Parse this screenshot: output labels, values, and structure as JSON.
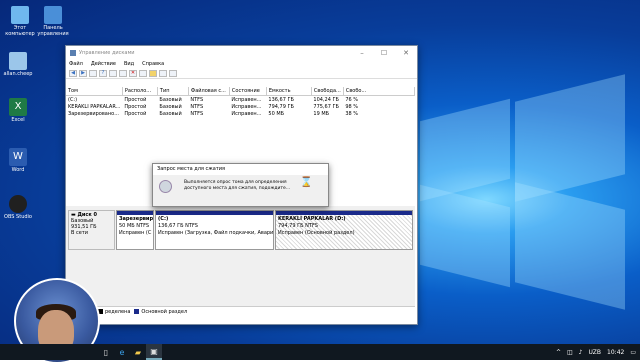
{
  "desktop": {
    "icons": [
      {
        "label": "Этот компьютер",
        "color": "#6fb7ee"
      },
      {
        "label": "Панель управления",
        "color": "#4a8fd8"
      },
      {
        "label": "allan.cheep",
        "color": "#9bc6ea"
      },
      {
        "label": "Excel",
        "color": "#1f7a45"
      },
      {
        "label": "Word",
        "color": "#2b5cb0"
      },
      {
        "label": "OBS Studio",
        "color": "#202020"
      }
    ]
  },
  "window": {
    "title": "Управление дисками",
    "menu": [
      "Файл",
      "Действие",
      "Вид",
      "Справка"
    ],
    "columns": [
      "Том",
      "Располо...",
      "Тип",
      "Файловая с...",
      "Состояние",
      "Емкость",
      "Свобода...",
      "Свобо..."
    ],
    "rows": [
      [
        "(C:)",
        "Простой",
        "Базовый",
        "NTFS",
        "Исправен...",
        "136,67 ГБ",
        "104,24 ГБ",
        "76 %"
      ],
      [
        "KERAKLI PAPKALAR...",
        "Простой",
        "Базовый",
        "NTFS",
        "Исправен...",
        "794,79 ГБ",
        "775,67 ГБ",
        "98 %"
      ],
      [
        "Зарезервировано...",
        "Простой",
        "Базовый",
        "NTFS",
        "Исправен...",
        "50 МБ",
        "19 МБ",
        "38 %"
      ]
    ],
    "disk": {
      "name": "Диск 0",
      "type": "Базовый",
      "size": "931,51 ГБ",
      "status": "В сети"
    },
    "partitions": [
      {
        "title": "Зарезервир",
        "l1": "50 МБ NTFS",
        "l2": "Исправен (С"
      },
      {
        "title": "(C:)",
        "l1": "136,67 ГБ NTFS",
        "l2": "Исправен (Загрузка, Файл подкачки, Аварии"
      },
      {
        "title": "KERAKLI PAPKALAR (D:)",
        "l1": "794,79 ГБ NTFS",
        "l2": "Исправен (Основной раздел)"
      }
    ],
    "legend": [
      {
        "label": "ределена",
        "color": "#000000"
      },
      {
        "label": "Основной раздел",
        "color": "#1a2a8a"
      }
    ]
  },
  "dialog": {
    "title": "Запрос места для сжатия",
    "message": "Выполняется опрос тома для определения доступного места для сжатия, подождите..."
  },
  "taskbar": {
    "lang": "UZB",
    "time": "10:42"
  }
}
